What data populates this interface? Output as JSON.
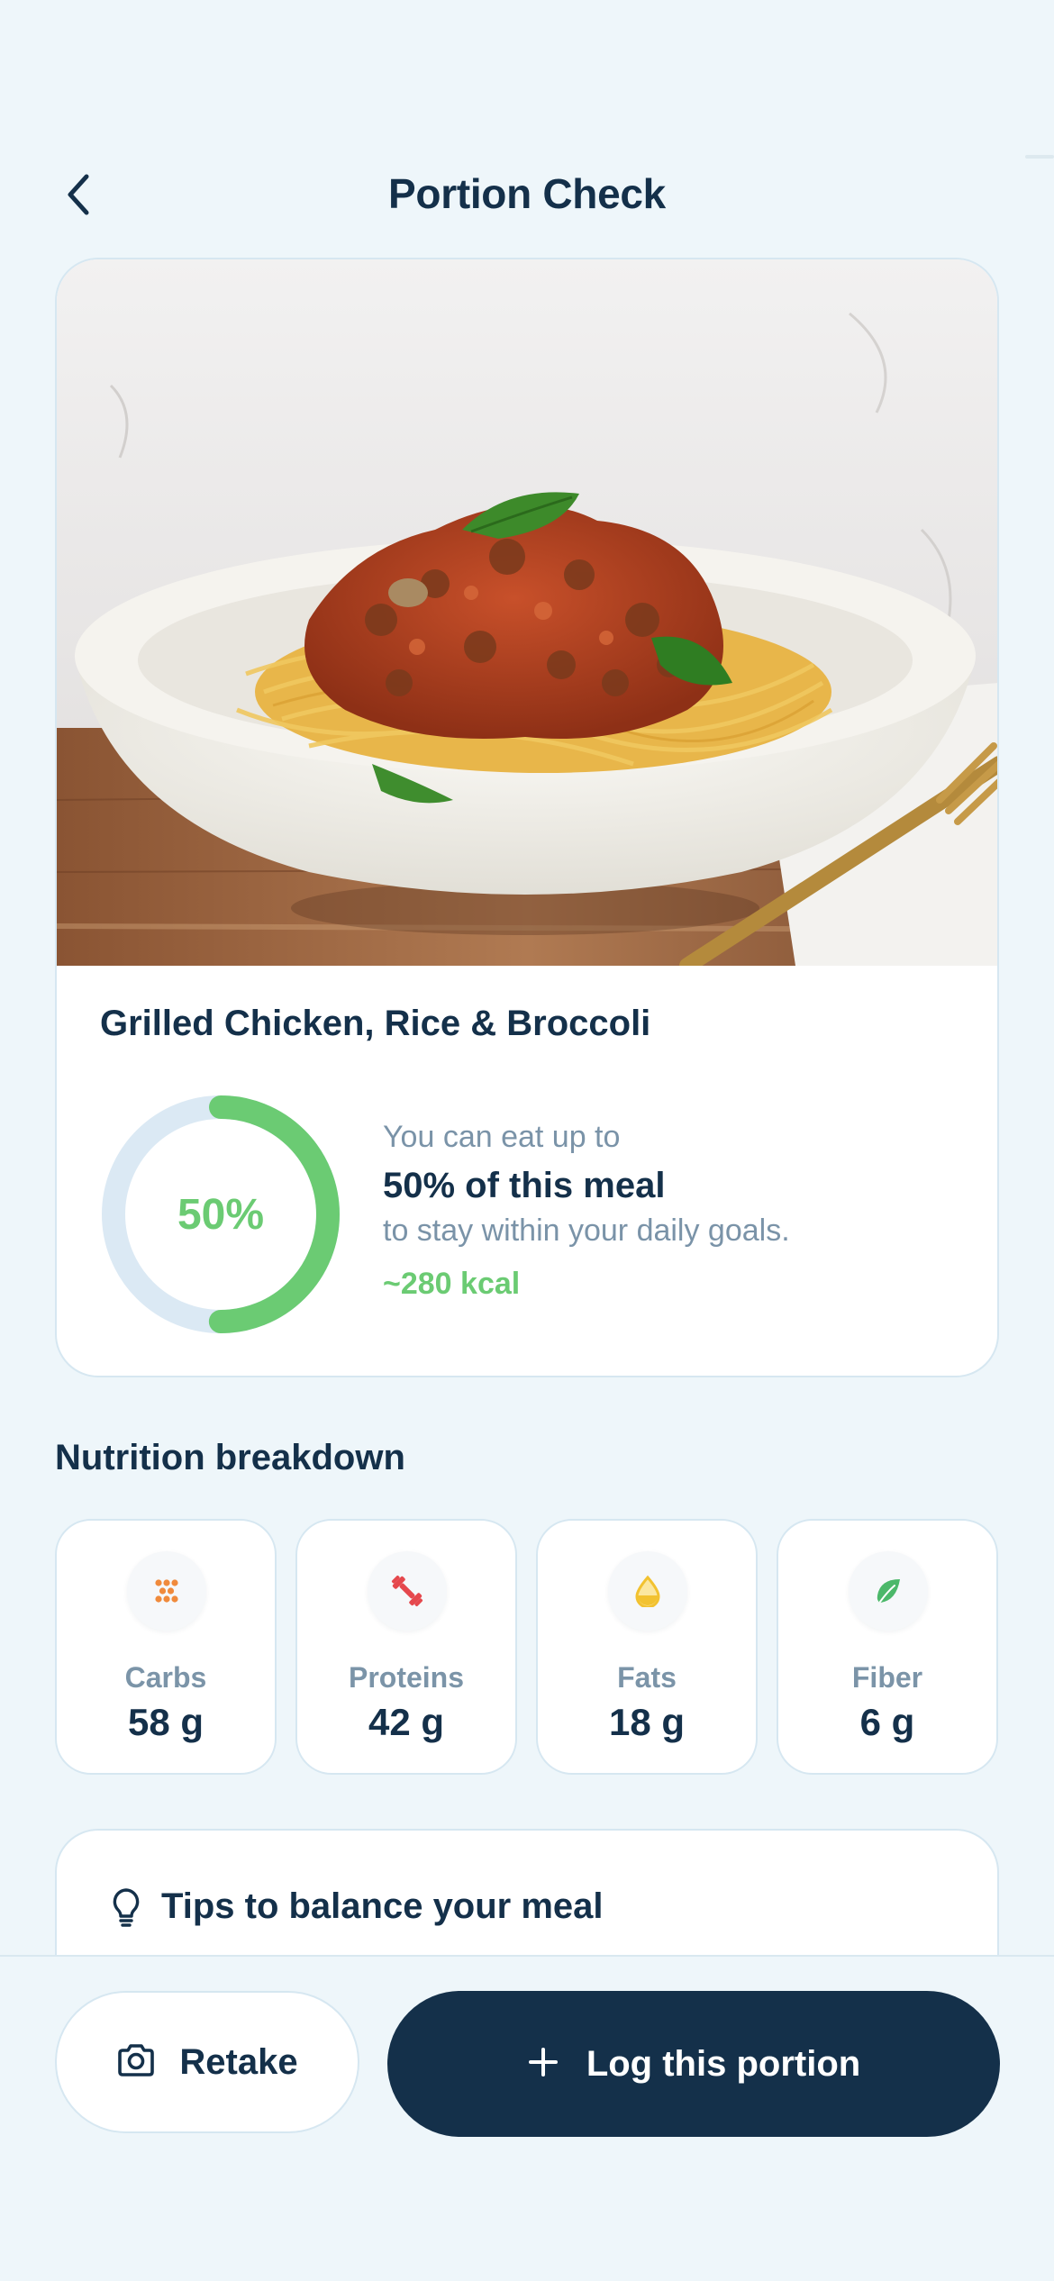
{
  "header": {
    "title": "Portion Check",
    "back_icon": "chevron-left-icon"
  },
  "meal": {
    "name": "Grilled Chicken, Rice & Broccoli",
    "portion_percent": 50,
    "portion_label": "50%",
    "allowance_prefix": "You can eat up to",
    "allowance_main": "50% of this meal",
    "allowance_suffix": "to stay within your daily goals.",
    "calories": "~280 kcal"
  },
  "nutrition": {
    "title": "Nutrition breakdown",
    "items": [
      {
        "label": "Carbs",
        "value": "58 g",
        "icon": "grain-icon",
        "color": "#f08a3c"
      },
      {
        "label": "Proteins",
        "value": "42 g",
        "icon": "dumbbell-icon",
        "color": "#e5484d"
      },
      {
        "label": "Fats",
        "value": "18 g",
        "icon": "oil-drop-icon",
        "color": "#f2c230"
      },
      {
        "label": "Fiber",
        "value": "6 g",
        "icon": "leaf-icon",
        "color": "#4cb86a"
      }
    ]
  },
  "tips": {
    "title": "Tips to balance your meal",
    "icon": "lightbulb-icon"
  },
  "actions": {
    "retake_label": "Retake",
    "retake_icon": "camera-icon",
    "log_label": "Log this portion",
    "log_icon": "plus-icon"
  },
  "colors": {
    "background": "#eef6fa",
    "primary": "#14304a",
    "accent_green": "#6bcb73",
    "ring_track": "#dbe9f4",
    "muted_text": "#7a93a8"
  }
}
